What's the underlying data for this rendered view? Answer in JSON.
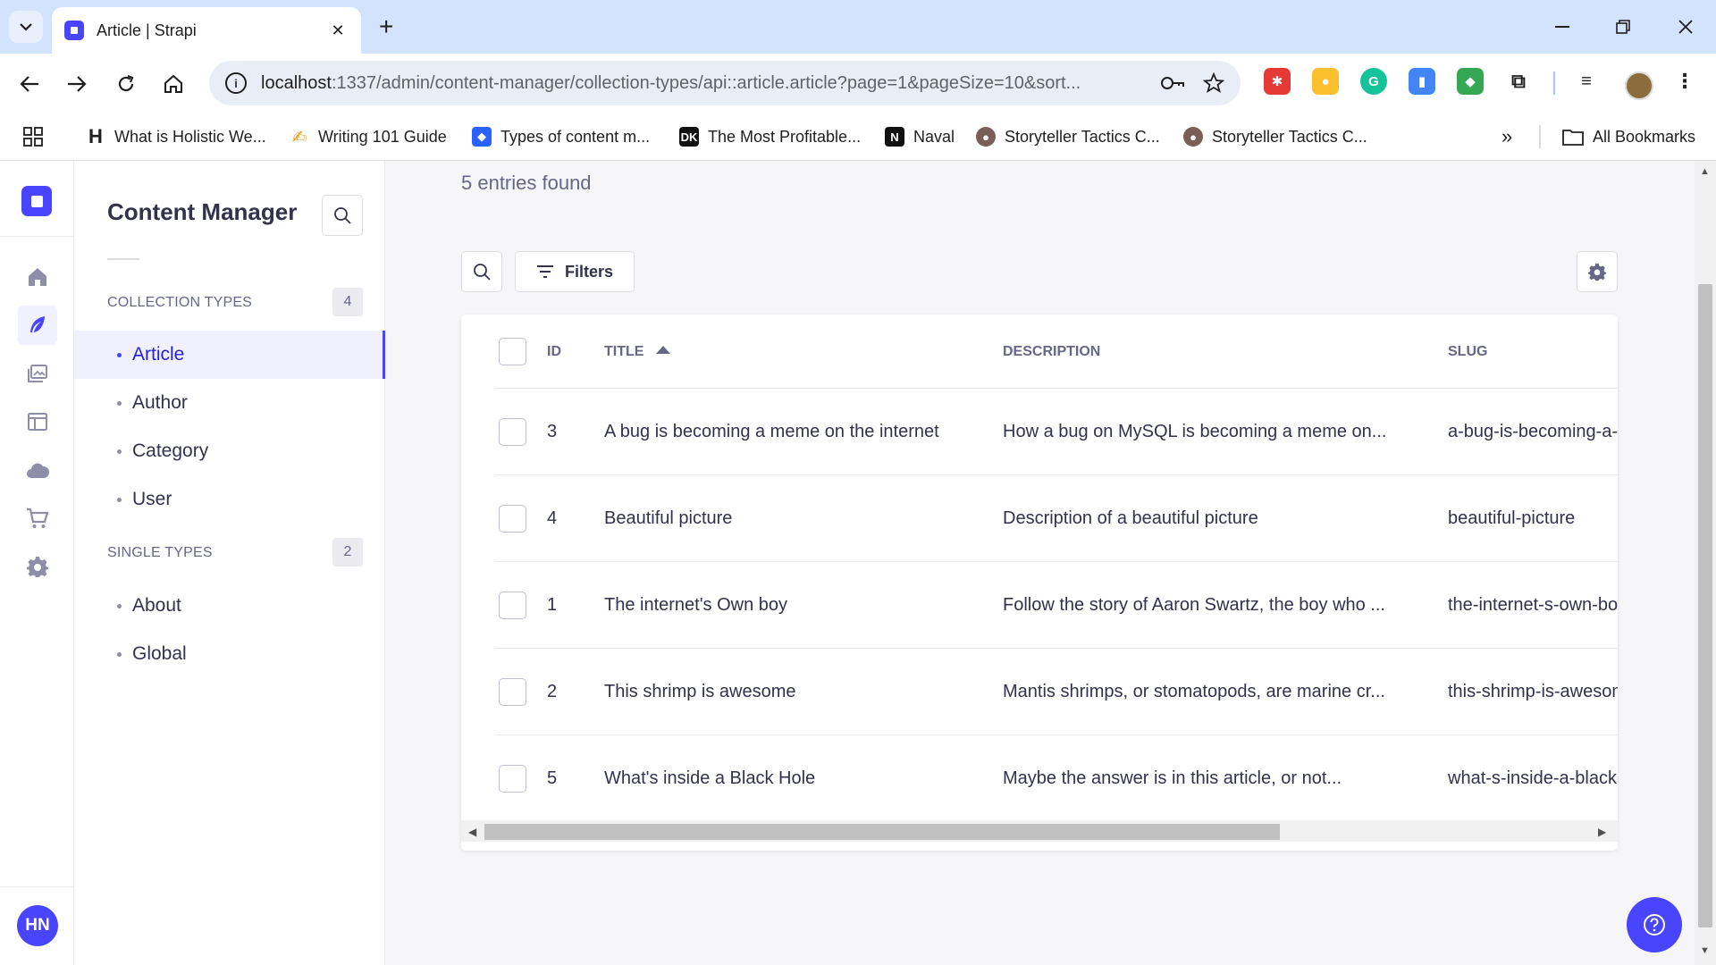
{
  "browser": {
    "tab_title": "Article | Strapi",
    "url_host": "localhost",
    "url_rest": ":1337/admin/content-manager/collection-types/api::article.article?page=1&pageSize=10&sort...",
    "bookmarks": [
      {
        "label": "What is Holistic We...",
        "icon": "H"
      },
      {
        "label": "Writing 101 Guide",
        "icon": "✍"
      },
      {
        "label": "Types of content m...",
        "icon": "◆"
      },
      {
        "label": "The Most Profitable...",
        "icon": "DK"
      },
      {
        "label": "Naval",
        "icon": "N"
      },
      {
        "label": "Storyteller Tactics C...",
        "icon": "●"
      },
      {
        "label": "Storyteller Tactics C...",
        "icon": "●"
      }
    ],
    "all_bookmarks": "All Bookmarks",
    "more_bookmarks": "»"
  },
  "subnav": {
    "title": "Content Manager",
    "collection_label": "COLLECTION TYPES",
    "collection_count": "4",
    "collection_items": [
      "Article",
      "Author",
      "Category",
      "User"
    ],
    "single_label": "SINGLE TYPES",
    "single_count": "2",
    "single_items": [
      "About",
      "Global"
    ]
  },
  "user": {
    "initials": "HN"
  },
  "main": {
    "entries": "5 entries found",
    "filters_label": "Filters"
  },
  "table": {
    "headers": {
      "id": "ID",
      "title": "TITLE",
      "description": "DESCRIPTION",
      "slug": "SLUG"
    },
    "rows": [
      {
        "id": "3",
        "title": "A bug is becoming a meme on the internet",
        "description": "How a bug on MySQL is becoming a meme on...",
        "slug": "a-bug-is-becoming-a-meme"
      },
      {
        "id": "4",
        "title": "Beautiful picture",
        "description": "Description of a beautiful picture",
        "slug": "beautiful-picture"
      },
      {
        "id": "1",
        "title": "The internet's Own boy",
        "description": "Follow the story of Aaron Swartz, the boy who ...",
        "slug": "the-internet-s-own-boy"
      },
      {
        "id": "2",
        "title": "This shrimp is awesome",
        "description": "Mantis shrimps, or stomatopods, are marine cr...",
        "slug": "this-shrimp-is-awesome"
      },
      {
        "id": "5",
        "title": "What's inside a Black Hole",
        "description": "Maybe the answer is in this article, or not...",
        "slug": "what-s-inside-a-black-hole"
      }
    ]
  },
  "colors": {
    "accent": "#4945ff",
    "active_bg": "#f0f0ff",
    "active_text": "#271fe0"
  }
}
